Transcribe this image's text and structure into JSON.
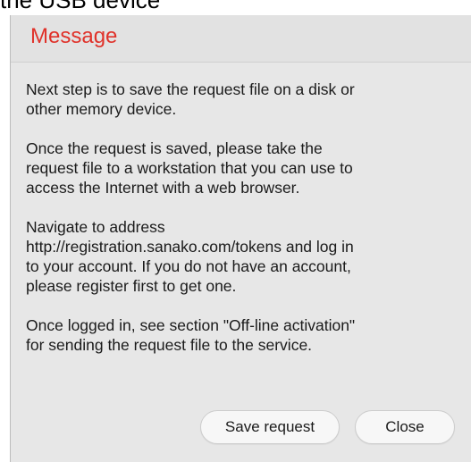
{
  "background": {
    "partial_text": "the USB device"
  },
  "dialog": {
    "title": "Message",
    "paragraphs": [
      "Next step is to save the request file on a disk or\nother memory device.",
      "Once the request is saved, please take the\nrequest file to a workstation that you can use to\naccess the Internet with a web browser.",
      "Navigate to address\nhttp://registration.sanako.com/tokens and log in\nto your account. If you do not have an account,\nplease register first to get one.",
      "Once logged in, see section \"Off-line activation\"\nfor sending the request file to the service."
    ],
    "buttons": {
      "save_label": "Save request",
      "close_label": "Close"
    }
  },
  "colors": {
    "title": "#e0322a",
    "dialog_background": "#e7e7e7",
    "button_background": "#f7f7f7"
  }
}
